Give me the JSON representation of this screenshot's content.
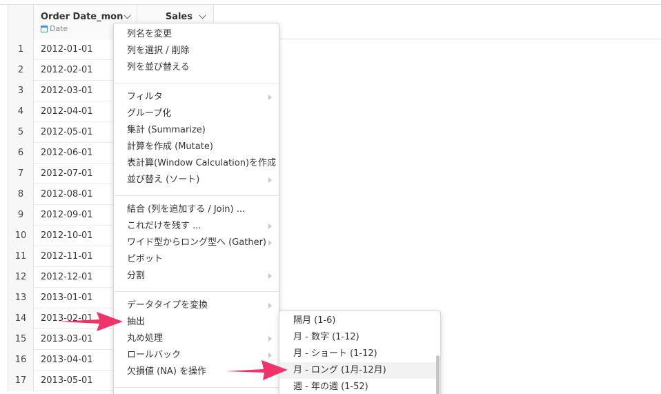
{
  "table": {
    "columns": [
      {
        "name": "Order Date_mon",
        "type": "Date"
      },
      {
        "name": "Sales",
        "type": ""
      }
    ],
    "rows": [
      {
        "index": "1",
        "date": "2012-01-01"
      },
      {
        "index": "2",
        "date": "2012-02-01"
      },
      {
        "index": "3",
        "date": "2012-03-01"
      },
      {
        "index": "4",
        "date": "2012-04-01"
      },
      {
        "index": "5",
        "date": "2012-05-01"
      },
      {
        "index": "6",
        "date": "2012-06-01"
      },
      {
        "index": "7",
        "date": "2012-07-01"
      },
      {
        "index": "8",
        "date": "2012-08-01"
      },
      {
        "index": "9",
        "date": "2012-09-01"
      },
      {
        "index": "10",
        "date": "2012-10-01"
      },
      {
        "index": "11",
        "date": "2012-11-01"
      },
      {
        "index": "12",
        "date": "2012-12-01"
      },
      {
        "index": "13",
        "date": "2013-01-01"
      },
      {
        "index": "14",
        "date": "2013-02-01"
      },
      {
        "index": "15",
        "date": "2013-03-01"
      },
      {
        "index": "16",
        "date": "2013-04-01"
      },
      {
        "index": "17",
        "date": "2013-05-01"
      }
    ]
  },
  "menu": {
    "items": [
      "列名を変更",
      "列を選択 / 削除",
      "列を並び替える",
      "フィルタ",
      "グループ化",
      "集計 (Summarize)",
      "計算を作成 (Mutate)",
      "表計算(Window Calculation)を作成",
      "並び替え (ソート)",
      "結合 (列を追加する / Join) ...",
      "これだけを残す ...",
      "ワイド型からロング型へ (Gather)",
      "ピボット",
      "分割",
      "データタイプを変換",
      "抽出",
      "丸め処理",
      "ロールバック",
      "欠損値 (NA) を操作"
    ]
  },
  "submenu": {
    "items": [
      "隔月 (1-6)",
      "月 - 数字 (1-12)",
      "月 - ショート (1-12)",
      "月 - ロング (1月-12月)",
      "週 - 年の週 (1-52)"
    ],
    "highlighted": "月 - ロング (1月-12月)"
  },
  "colors": {
    "arrow": "#f0336a",
    "calendar_icon": "#3a94d8"
  }
}
